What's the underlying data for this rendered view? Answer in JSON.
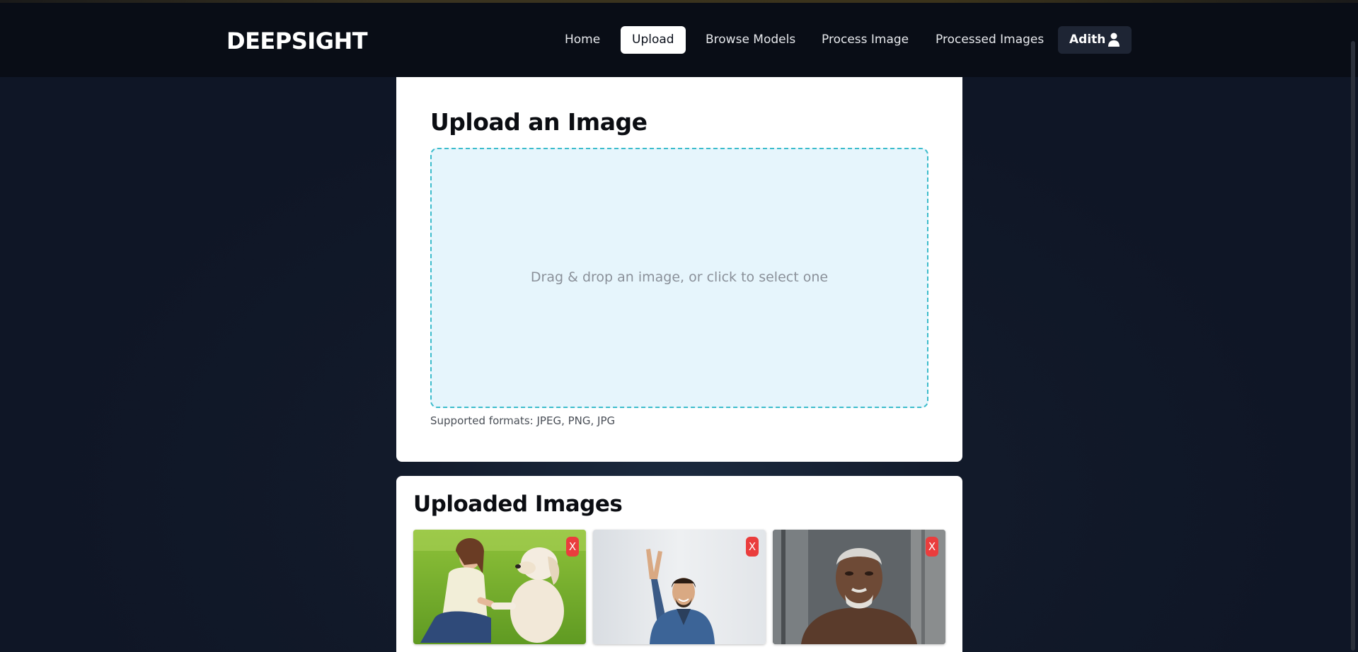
{
  "brand": "DEEPSIGHT",
  "nav": {
    "items": [
      {
        "label": "Home"
      },
      {
        "label": "Upload",
        "active": true
      },
      {
        "label": "Browse Models"
      },
      {
        "label": "Process Image"
      },
      {
        "label": "Processed Images"
      }
    ],
    "user": {
      "name": "Adith",
      "icon": "user-icon"
    }
  },
  "upload": {
    "title": "Upload an Image",
    "dropzone_text": "Drag & drop an image, or click to select one",
    "formats_text": "Supported formats: JPEG, PNG, JPG"
  },
  "uploaded": {
    "title": "Uploaded Images",
    "images": [
      {
        "subject": "woman-with-dog",
        "delete_label": "X"
      },
      {
        "subject": "man-peace-sign",
        "delete_label": "X"
      },
      {
        "subject": "elderly-man",
        "delete_label": "X"
      }
    ]
  },
  "colors": {
    "navbar_bg": "#090d16",
    "page_bg": "#121a2a",
    "dropzone_bg": "#e6f5fc",
    "dropzone_border": "#3cbccc",
    "delete_button": "#ea3d3d"
  }
}
